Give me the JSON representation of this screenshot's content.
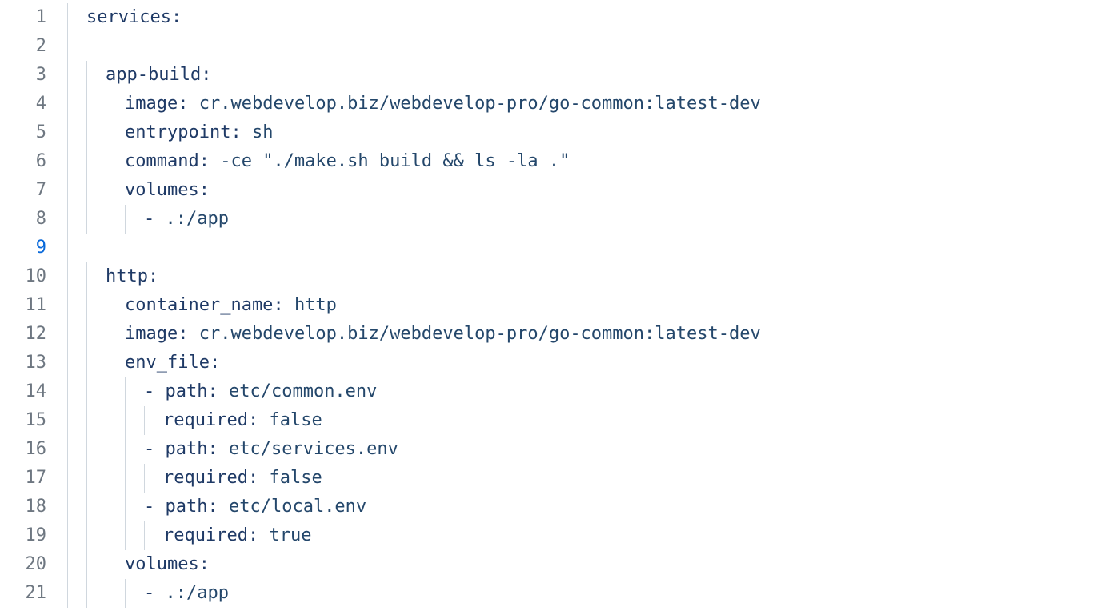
{
  "colors": {
    "currentLineBorder": "#0969da",
    "currentGutter": "#0969da",
    "gutter": "#6e7781",
    "indentGuide": "#d0d7de",
    "key": "#1f3a66",
    "value": "#24476b"
  },
  "currentLine": 9,
  "lines": [
    {
      "n": 1,
      "indent": 1,
      "tokens": [
        {
          "t": "services",
          "c": "tok-key1"
        },
        {
          "t": ":",
          "c": "tok-colon"
        }
      ]
    },
    {
      "n": 2,
      "indent": 1,
      "tokens": []
    },
    {
      "n": 3,
      "indent": 2,
      "tokens": [
        {
          "t": "app-build",
          "c": "tok-key1"
        },
        {
          "t": ":",
          "c": "tok-colon"
        }
      ]
    },
    {
      "n": 4,
      "indent": 3,
      "tokens": [
        {
          "t": "image",
          "c": "tok-key2"
        },
        {
          "t": ":",
          "c": "tok-colon"
        },
        {
          "t": " ",
          "c": ""
        },
        {
          "t": "cr.webdevelop.biz/webdevelop-pro/go-common:latest-dev",
          "c": "tok-val"
        }
      ]
    },
    {
      "n": 5,
      "indent": 3,
      "tokens": [
        {
          "t": "entrypoint",
          "c": "tok-key2"
        },
        {
          "t": ":",
          "c": "tok-colon"
        },
        {
          "t": " ",
          "c": ""
        },
        {
          "t": "sh",
          "c": "tok-val"
        }
      ]
    },
    {
      "n": 6,
      "indent": 3,
      "tokens": [
        {
          "t": "command",
          "c": "tok-key2"
        },
        {
          "t": ":",
          "c": "tok-colon"
        },
        {
          "t": " ",
          "c": ""
        },
        {
          "t": "-ce \"./make.sh build && ls -la .\"",
          "c": "tok-val"
        }
      ]
    },
    {
      "n": 7,
      "indent": 3,
      "tokens": [
        {
          "t": "volumes",
          "c": "tok-key2"
        },
        {
          "t": ":",
          "c": "tok-colon"
        }
      ]
    },
    {
      "n": 8,
      "indent": 4,
      "tokens": [
        {
          "t": "- ",
          "c": "tok-dash"
        },
        {
          "t": ".:/app",
          "c": "tok-val"
        }
      ]
    },
    {
      "n": 9,
      "indent": 1,
      "tokens": []
    },
    {
      "n": 10,
      "indent": 2,
      "tokens": [
        {
          "t": "http",
          "c": "tok-key1"
        },
        {
          "t": ":",
          "c": "tok-colon"
        }
      ]
    },
    {
      "n": 11,
      "indent": 3,
      "tokens": [
        {
          "t": "container_name",
          "c": "tok-key2"
        },
        {
          "t": ":",
          "c": "tok-colon"
        },
        {
          "t": " ",
          "c": ""
        },
        {
          "t": "http",
          "c": "tok-val"
        }
      ]
    },
    {
      "n": 12,
      "indent": 3,
      "tokens": [
        {
          "t": "image",
          "c": "tok-key2"
        },
        {
          "t": ":",
          "c": "tok-colon"
        },
        {
          "t": " ",
          "c": ""
        },
        {
          "t": "cr.webdevelop.biz/webdevelop-pro/go-common:latest-dev",
          "c": "tok-val"
        }
      ]
    },
    {
      "n": 13,
      "indent": 3,
      "tokens": [
        {
          "t": "env_file",
          "c": "tok-key2"
        },
        {
          "t": ":",
          "c": "tok-colon"
        }
      ]
    },
    {
      "n": 14,
      "indent": 4,
      "tokens": [
        {
          "t": "- ",
          "c": "tok-dash"
        },
        {
          "t": "path",
          "c": "tok-key2"
        },
        {
          "t": ":",
          "c": "tok-colon"
        },
        {
          "t": " ",
          "c": ""
        },
        {
          "t": "etc/common.env",
          "c": "tok-val"
        }
      ]
    },
    {
      "n": 15,
      "indent": 5,
      "tokens": [
        {
          "t": "required",
          "c": "tok-key2"
        },
        {
          "t": ":",
          "c": "tok-colon"
        },
        {
          "t": " ",
          "c": ""
        },
        {
          "t": "false",
          "c": "tok-val"
        }
      ]
    },
    {
      "n": 16,
      "indent": 4,
      "tokens": [
        {
          "t": "- ",
          "c": "tok-dash"
        },
        {
          "t": "path",
          "c": "tok-key2"
        },
        {
          "t": ":",
          "c": "tok-colon"
        },
        {
          "t": " ",
          "c": ""
        },
        {
          "t": "etc/services.env",
          "c": "tok-val"
        }
      ]
    },
    {
      "n": 17,
      "indent": 5,
      "tokens": [
        {
          "t": "required",
          "c": "tok-key2"
        },
        {
          "t": ":",
          "c": "tok-colon"
        },
        {
          "t": " ",
          "c": ""
        },
        {
          "t": "false",
          "c": "tok-val"
        }
      ]
    },
    {
      "n": 18,
      "indent": 4,
      "tokens": [
        {
          "t": "- ",
          "c": "tok-dash"
        },
        {
          "t": "path",
          "c": "tok-key2"
        },
        {
          "t": ":",
          "c": "tok-colon"
        },
        {
          "t": " ",
          "c": ""
        },
        {
          "t": "etc/local.env",
          "c": "tok-val"
        }
      ]
    },
    {
      "n": 19,
      "indent": 5,
      "tokens": [
        {
          "t": "required",
          "c": "tok-key2"
        },
        {
          "t": ":",
          "c": "tok-colon"
        },
        {
          "t": " ",
          "c": ""
        },
        {
          "t": "true",
          "c": "tok-val"
        }
      ]
    },
    {
      "n": 20,
      "indent": 3,
      "tokens": [
        {
          "t": "volumes",
          "c": "tok-key2"
        },
        {
          "t": ":",
          "c": "tok-colon"
        }
      ]
    },
    {
      "n": 21,
      "indent": 4,
      "tokens": [
        {
          "t": "- ",
          "c": "tok-dash"
        },
        {
          "t": ".:/app",
          "c": "tok-val"
        }
      ]
    }
  ]
}
